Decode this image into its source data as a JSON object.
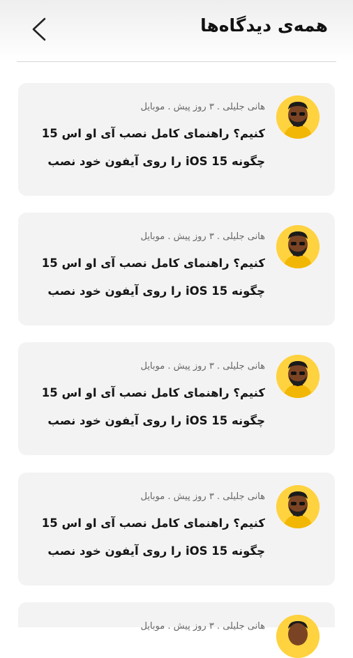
{
  "header": {
    "title": "همه‌ی دیدگاه‌ها",
    "back_icon": "chevron-left-icon"
  },
  "comments": [
    {
      "meta": "هانی جلیلی . ۳ روز پیش . موبایل",
      "line1": "کنیم؟ راهنمای کامل نصب آی او اس 15",
      "line2": "چگونه iOS 15 را روی آیفون خود نصب"
    },
    {
      "meta": "هانی جلیلی . ۳ روز پیش . موبایل",
      "line1": "کنیم؟ راهنمای کامل نصب آی او اس 15",
      "line2": "چگونه iOS 15 را روی آیفون خود نصب"
    },
    {
      "meta": "هانی جلیلی . ۳ روز پیش . موبایل",
      "line1": "کنیم؟ راهنمای کامل نصب آی او اس 15",
      "line2": "چگونه iOS 15 را روی آیفون خود نصب"
    },
    {
      "meta": "هانی جلیلی . ۳ روز پیش . موبایل",
      "line1": "کنیم؟ راهنمای کامل نصب آی او اس 15",
      "line2": "چگونه iOS 15 را روی آیفون خود نصب"
    },
    {
      "meta": "هانی جلیلی . ۳ روز پیش . موبایل",
      "line1": "",
      "line2": ""
    }
  ],
  "colors": {
    "card_bg": "#f3f3f3",
    "avatar_bg": "#ffd23f"
  }
}
